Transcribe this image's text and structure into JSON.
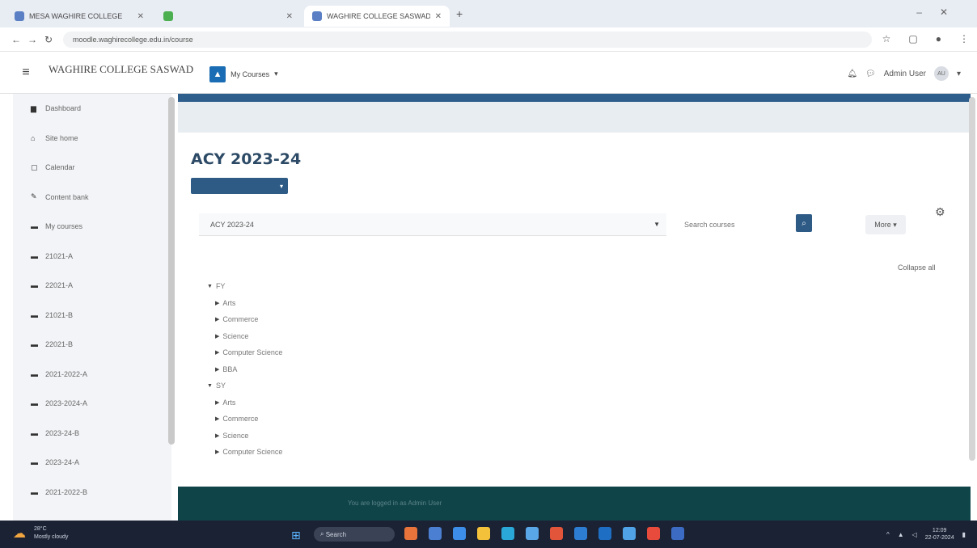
{
  "browser": {
    "tabs": [
      {
        "label": "MESA WAGHIRE COLLEGE",
        "active": false
      },
      {
        "label": "",
        "active": false
      },
      {
        "label": "WAGHIRE COLLEGE SASWAD",
        "active": true
      }
    ],
    "url": "moodle.waghirecollege.edu.in/course"
  },
  "navbar": {
    "site_name": "WAGHIRE COLLEGE SASWAD",
    "my_courses": "My Courses",
    "user_name": "Admin User",
    "avatar_initials": "AU"
  },
  "sidebar": {
    "items": [
      {
        "icon": "dashboard-icon",
        "label": "Dashboard"
      },
      {
        "icon": "home-icon",
        "label": "Site home"
      },
      {
        "icon": "calendar-icon",
        "label": "Calendar"
      },
      {
        "icon": "content-bank-icon",
        "label": "Content bank"
      },
      {
        "icon": "graduation-cap-icon",
        "label": "My courses"
      },
      {
        "icon": "graduation-cap-icon",
        "label": "21021-A"
      },
      {
        "icon": "graduation-cap-icon",
        "label": "22021-A"
      },
      {
        "icon": "graduation-cap-icon",
        "label": "21021-B"
      },
      {
        "icon": "graduation-cap-icon",
        "label": "22021-B"
      },
      {
        "icon": "graduation-cap-icon",
        "label": "2021-2022-A"
      },
      {
        "icon": "graduation-cap-icon",
        "label": "2023-2024-A"
      },
      {
        "icon": "graduation-cap-icon",
        "label": "2023-24-B"
      },
      {
        "icon": "graduation-cap-icon",
        "label": "2023-24-A"
      },
      {
        "icon": "graduation-cap-icon",
        "label": "2021-2022-B"
      }
    ]
  },
  "main": {
    "page_title": "ACY 2023-24",
    "category_select": "ACY 2023-24",
    "search_placeholder": "Search courses",
    "more_label": "More",
    "collapse_all": "Collapse all",
    "tree": [
      {
        "level": 1,
        "label": "FY"
      },
      {
        "level": 2,
        "label": "Arts"
      },
      {
        "level": 2,
        "label": "Commerce"
      },
      {
        "level": 2,
        "label": "Science"
      },
      {
        "level": 2,
        "label": "Computer Science"
      },
      {
        "level": 2,
        "label": "BBA"
      },
      {
        "level": 1,
        "label": "SY"
      },
      {
        "level": 2,
        "label": "Arts"
      },
      {
        "level": 2,
        "label": "Commerce"
      },
      {
        "level": 2,
        "label": "Science"
      },
      {
        "level": 2,
        "label": "Computer Science"
      }
    ],
    "footer_text": "You are logged in as Admin User"
  },
  "taskbar": {
    "weather_temp": "28°C",
    "weather_desc": "Mostly cloudy",
    "search_label": "Search",
    "time": "12:09",
    "date": "22-07-2024"
  }
}
